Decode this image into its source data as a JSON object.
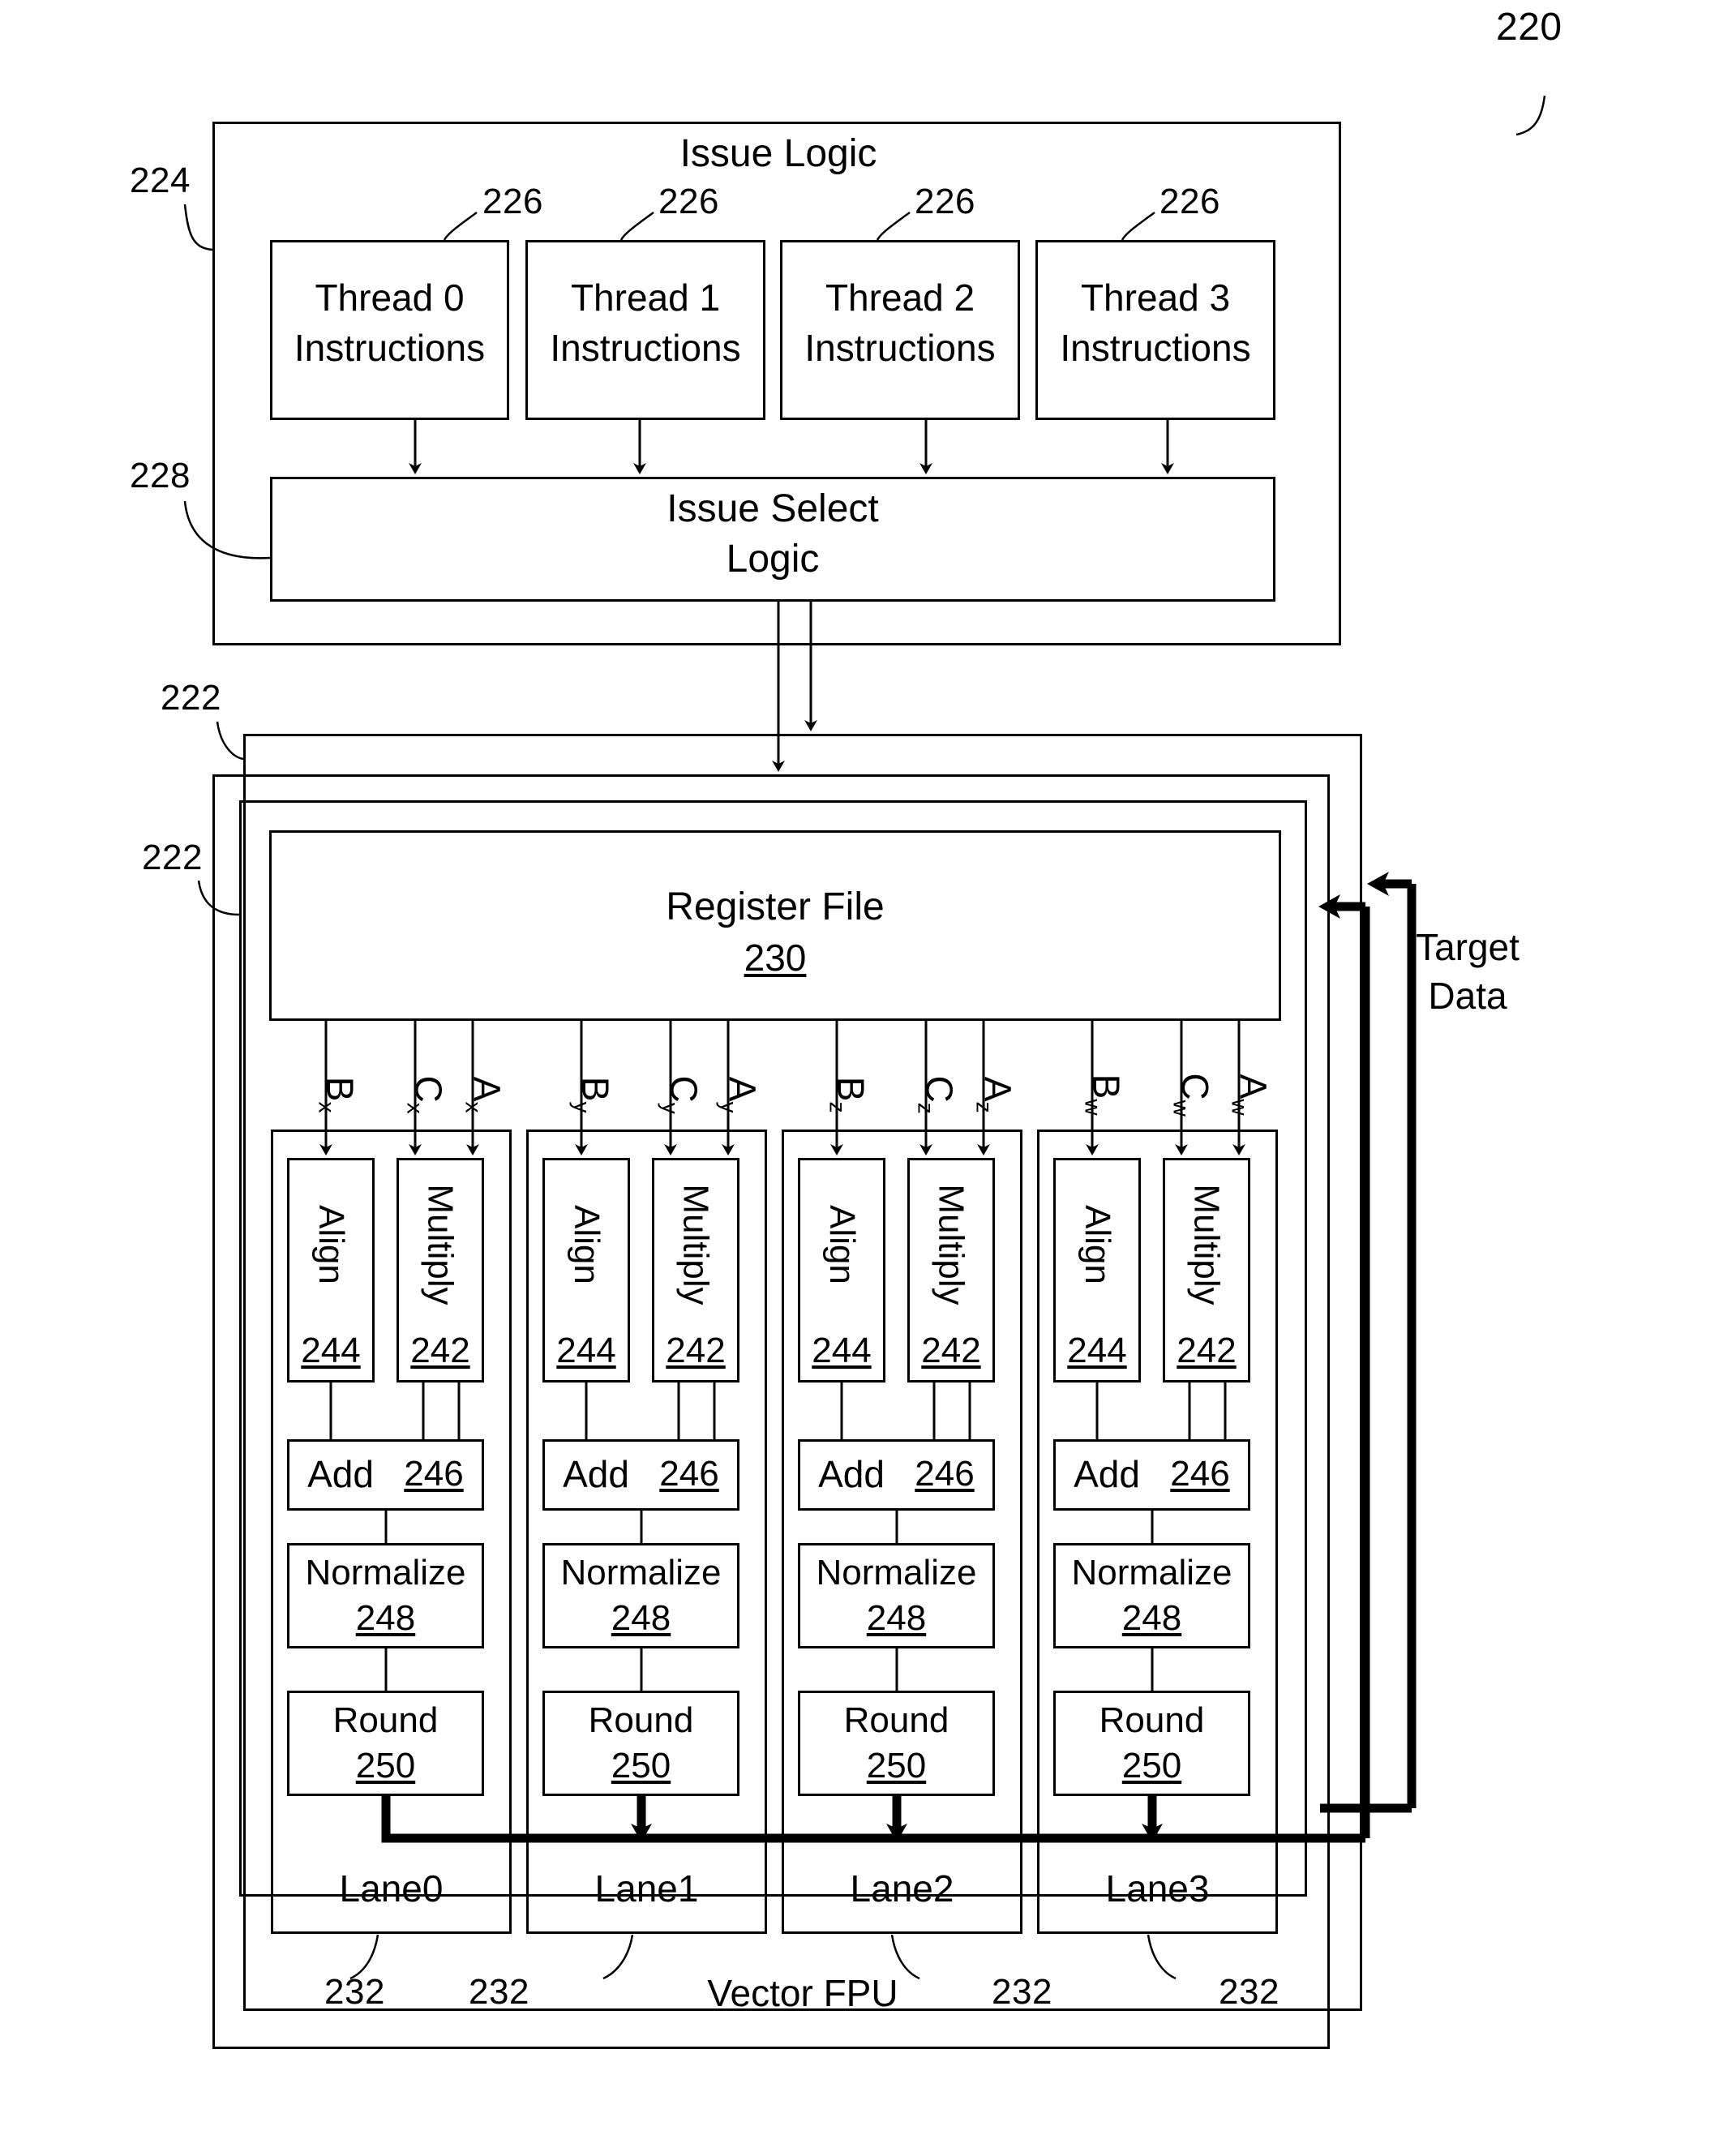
{
  "figure": {
    "number": "220",
    "issue_logic": {
      "title": "Issue Logic",
      "ref": "224",
      "thread_ref": "226",
      "threads": [
        {
          "line1": "Thread 0",
          "line2": "Instructions"
        },
        {
          "line1": "Thread 1",
          "line2": "Instructions"
        },
        {
          "line1": "Thread 2",
          "line2": "Instructions"
        },
        {
          "line1": "Thread 3",
          "line2": "Instructions"
        }
      ],
      "issue_select": {
        "line1": "Issue Select",
        "line2": "Logic",
        "ref": "228"
      }
    },
    "vector_fpu": {
      "title": "Vector FPU",
      "ref": "222",
      "ref2": "222",
      "register_file": {
        "title": "Register File",
        "ref": "230"
      },
      "target_data": {
        "line1": "Target",
        "line2": "Data"
      },
      "lane_ref": "232",
      "operand_labels": [
        {
          "letter": "B",
          "sub": "x"
        },
        {
          "letter": "C",
          "sub": "x"
        },
        {
          "letter": "A",
          "sub": "x"
        },
        {
          "letter": "B",
          "sub": "y"
        },
        {
          "letter": "C",
          "sub": "y"
        },
        {
          "letter": "A",
          "sub": "y"
        },
        {
          "letter": "B",
          "sub": "z"
        },
        {
          "letter": "C",
          "sub": "z"
        },
        {
          "letter": "A",
          "sub": "z"
        },
        {
          "letter": "B",
          "sub": "w"
        },
        {
          "letter": "C",
          "sub": "w"
        },
        {
          "letter": "A",
          "sub": "w"
        }
      ],
      "stages": {
        "align": {
          "label": "Align",
          "ref": "244"
        },
        "multiply": {
          "label": "Multiply",
          "ref": "242"
        },
        "add": {
          "label": "Add",
          "ref": "246"
        },
        "normalize": {
          "label": "Normalize",
          "ref": "248"
        },
        "round": {
          "label": "Round",
          "ref": "250"
        }
      },
      "lanes": [
        {
          "name": "Lane0"
        },
        {
          "name": "Lane1"
        },
        {
          "name": "Lane2"
        },
        {
          "name": "Lane3"
        }
      ]
    }
  }
}
